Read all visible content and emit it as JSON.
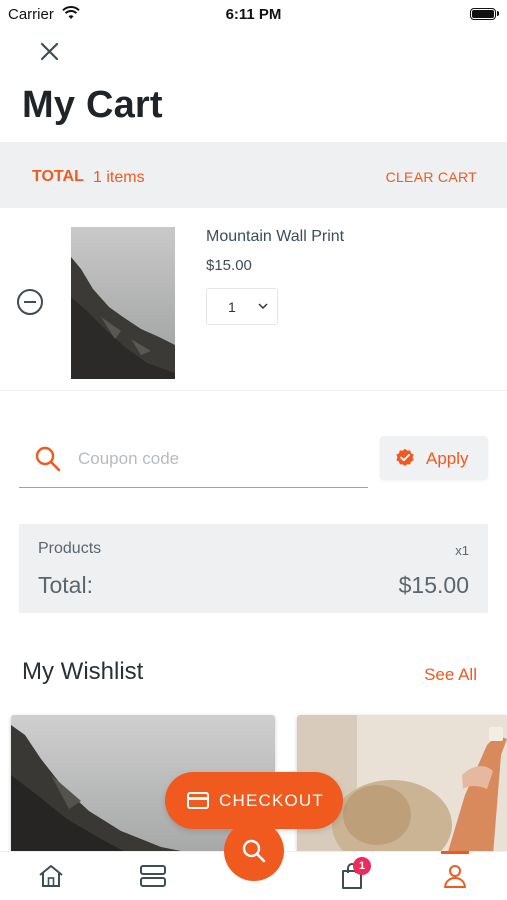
{
  "status_bar": {
    "carrier": "Carrier",
    "time": "6:11 PM"
  },
  "header": {
    "title": "My Cart",
    "close_icon": "close-icon"
  },
  "cart_summary_bar": {
    "total_label": "TOTAL",
    "items_count": "1 items",
    "clear_label": "CLEAR CART"
  },
  "cart_items": [
    {
      "name": "Mountain Wall Print",
      "price": "$15.00",
      "quantity": "1",
      "remove_icon": "minus-circle-icon",
      "thumbnail": "mountain-print-image"
    }
  ],
  "coupon": {
    "placeholder": "Coupon code",
    "value": "",
    "apply_label": "Apply",
    "search_icon": "search-icon",
    "badge_icon": "verified-badge-icon"
  },
  "order_summary": {
    "products_label": "Products",
    "products_count": "x1",
    "total_label": "Total:",
    "total_value": "$15.00"
  },
  "wishlist": {
    "title": "My Wishlist",
    "see_all_label": "See All"
  },
  "checkout": {
    "label": "CHECKOUT",
    "icon": "credit-card-icon"
  },
  "tab_bar": {
    "items": [
      "home-icon",
      "categories-icon",
      "search-icon",
      "cart-icon",
      "profile-icon"
    ],
    "cart_badge": "1",
    "active": "profile-icon"
  },
  "colors": {
    "accent": "#f05a1f",
    "badge": "#ef2a5a",
    "panel": "#eef0f2",
    "text_dark": "#1f2429",
    "text_muted": "#5b666e"
  }
}
